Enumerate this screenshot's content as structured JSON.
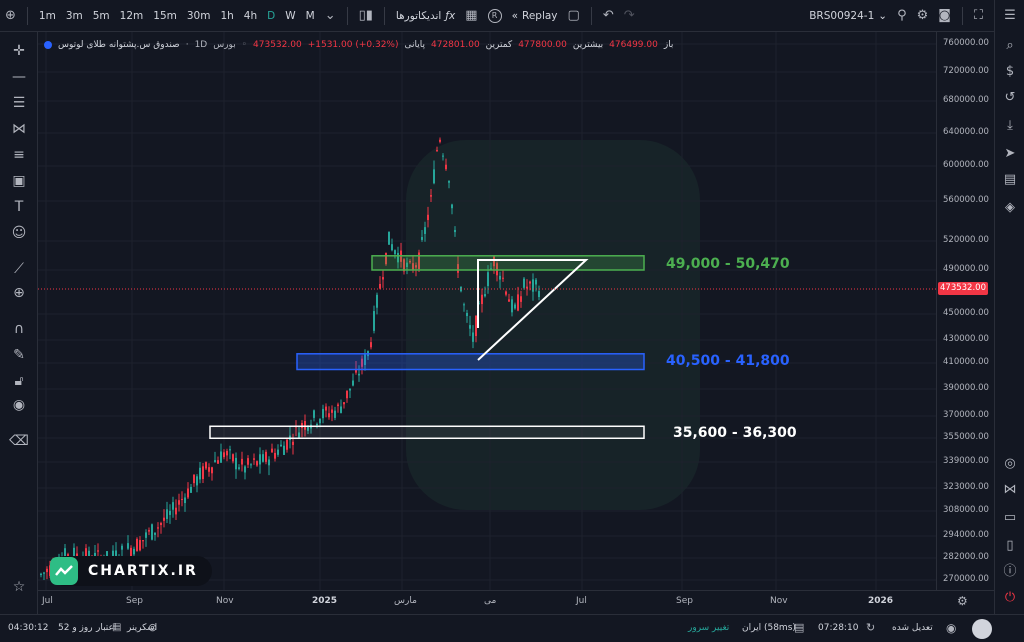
{
  "toolbar": {
    "timeframes": [
      "1m",
      "3m",
      "5m",
      "12m",
      "15m",
      "30m",
      "1h",
      "4h",
      "D",
      "W",
      "M"
    ],
    "active_timeframe": "D",
    "indicators_label": "اندیکاتورها",
    "replay_label": "Replay",
    "symbol": "BRS00924-1",
    "r_badge": "R"
  },
  "legend": {
    "name": "صندوق س.پشتوانه طلای لوتوس",
    "sep1": "·",
    "interval": "1D",
    "exchange": "بورس",
    "open_label": "باز",
    "open": "476499.00",
    "high_label": "بیشترین",
    "high": "477800.00",
    "low_label": "کمترین",
    "low": "472801.00",
    "close_label": "پایانی",
    "close": "473532.00",
    "change": "+1531.00 (+0.32%)"
  },
  "price_axis": {
    "labels": [
      "760000.00",
      "720000.00",
      "680000.00",
      "640000.00",
      "600000.00",
      "560000.00",
      "520000.00",
      "490000.00",
      "450000.00",
      "430000.00",
      "410000.00",
      "390000.00",
      "370000.00",
      "355000.00",
      "339000.00",
      "323000.00",
      "308000.00",
      "294000.00",
      "282000.00",
      "270000.00"
    ],
    "current": "473532.00"
  },
  "time_axis": {
    "labels": [
      "Jul",
      "Sep",
      "Nov",
      "2025",
      "مارس",
      "می",
      "Jul",
      "Sep",
      "Nov",
      "2026"
    ]
  },
  "zones": [
    {
      "label": "49,000 - 50,470",
      "color": "#4caf50"
    },
    {
      "label": "40,500 - 41,800",
      "color": "#2962ff"
    },
    {
      "label": "35,600 - 36,300",
      "color": "#ffffff"
    }
  ],
  "brand": {
    "text": "CHARTIX.IR"
  },
  "status": {
    "session_time": "04:30:12",
    "session_days": "52 روز و",
    "credit": "اعتبار",
    "screener": "اسکرینر",
    "server_change": "تغییر سرور",
    "server": "ایران (58ms)",
    "clock": "07:28:10",
    "adjusted": "تعدیل شده"
  },
  "colors": {
    "up": "#26a69a",
    "down": "#f23645",
    "background": "#131722"
  },
  "chart_data": {
    "type": "candlestick",
    "title": "",
    "x_range": [
      "2024-06",
      "2026-02"
    ],
    "ylim": [
      260000,
      770000
    ],
    "current_price": 473532,
    "zones": [
      {
        "low": 490000,
        "high": 504700,
        "label": "49,000 - 50,470"
      },
      {
        "low": 405000,
        "high": 418000,
        "label": "40,500 - 41,800"
      },
      {
        "low": 356000,
        "high": 363000,
        "label": "35,600 - 36,300"
      }
    ],
    "series": [
      {
        "x": "2024-07",
        "close": 270000
      },
      {
        "x": "2024-08",
        "close": 282000
      },
      {
        "x": "2024-09",
        "close": 294000
      },
      {
        "x": "2024-10",
        "close": 339000
      },
      {
        "x": "2024-11",
        "close": 323000
      },
      {
        "x": "2024-12",
        "close": 370000
      },
      {
        "x": "2025-01",
        "close": 360000
      },
      {
        "x": "2025-02",
        "close": 410000
      },
      {
        "x": "2025-03",
        "close": 470000
      },
      {
        "x": "2025-04",
        "close": 630000
      },
      {
        "x": "2025-05",
        "close": 440000
      },
      {
        "x": "2025-06",
        "close": 473532
      }
    ]
  }
}
